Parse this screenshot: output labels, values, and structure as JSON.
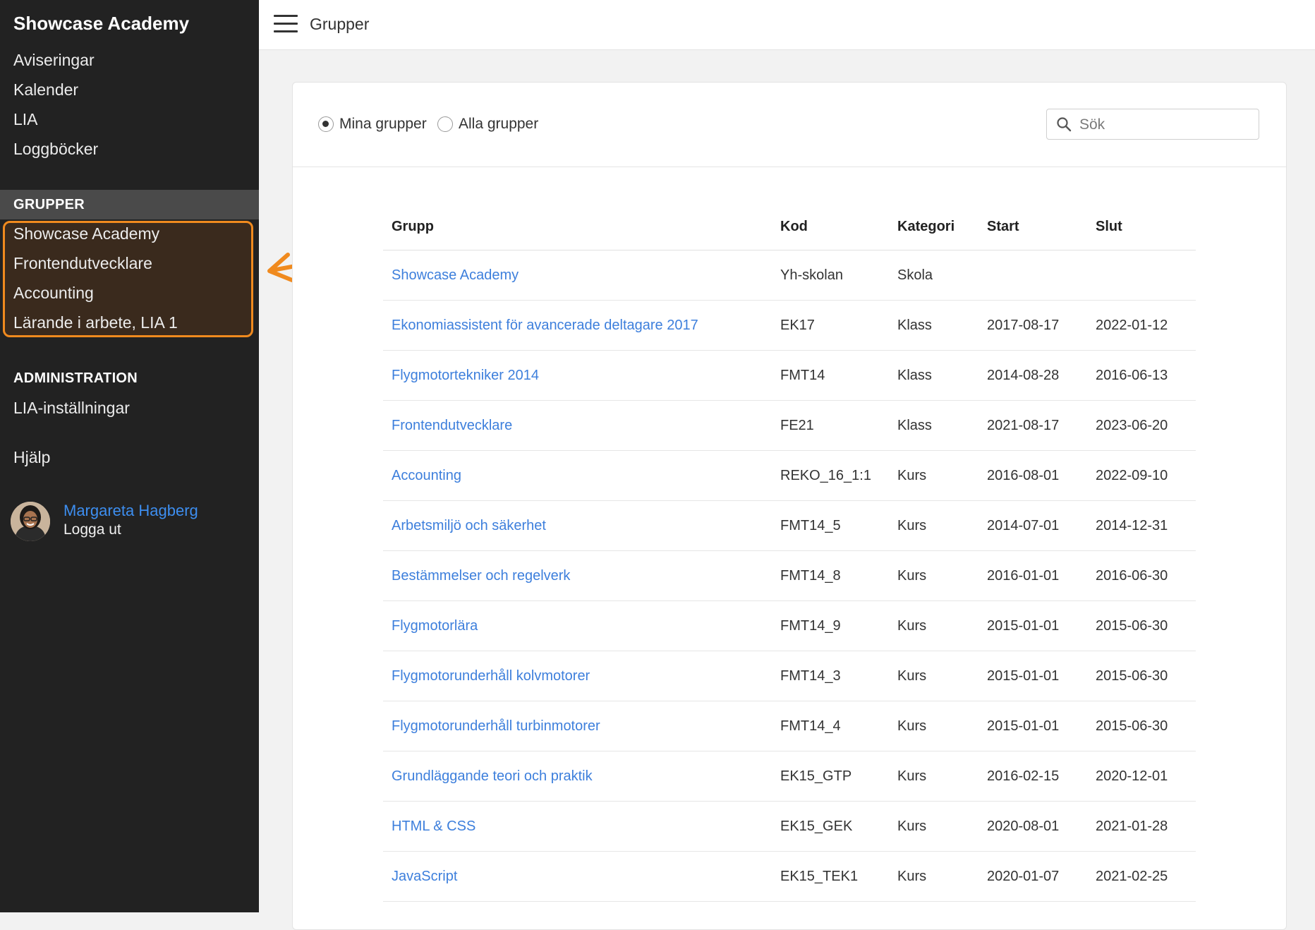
{
  "sidebar": {
    "brand": "Showcase Academy",
    "nav": [
      "Aviseringar",
      "Kalender",
      "LIA",
      "Loggböcker"
    ],
    "groups_heading": "GRUPPER",
    "groups": [
      "Showcase Academy",
      "Frontendutvecklare",
      "Accounting",
      "Lärande i arbete, LIA 1"
    ],
    "admin_heading": "ADMINISTRATION",
    "admin_items": [
      "LIA-inställningar"
    ],
    "help": "Hjälp",
    "user": {
      "name": "Margareta Hagberg",
      "logout": "Logga ut"
    }
  },
  "topbar": {
    "title": "Grupper"
  },
  "filters": {
    "mine": "Mina grupper",
    "all": "Alla grupper",
    "selected": "mine",
    "search_placeholder": "Sök"
  },
  "table": {
    "headers": [
      "Grupp",
      "Kod",
      "Kategori",
      "Start",
      "Slut"
    ],
    "rows": [
      [
        "Showcase Academy",
        "Yh-skolan",
        "Skola",
        "",
        ""
      ],
      [
        "Ekonomiassistent för avancerade deltagare 2017",
        "EK17",
        "Klass",
        "2017-08-17",
        "2022-01-12"
      ],
      [
        "Flygmotortekniker 2014",
        "FMT14",
        "Klass",
        "2014-08-28",
        "2016-06-13"
      ],
      [
        "Frontendutvecklare",
        "FE21",
        "Klass",
        "2021-08-17",
        "2023-06-20"
      ],
      [
        "Accounting",
        "REKO_16_1:1",
        "Kurs",
        "2016-08-01",
        "2022-09-10"
      ],
      [
        "Arbetsmiljö och säkerhet",
        "FMT14_5",
        "Kurs",
        "2014-07-01",
        "2014-12-31"
      ],
      [
        "Bestämmelser och regelverk",
        "FMT14_8",
        "Kurs",
        "2016-01-01",
        "2016-06-30"
      ],
      [
        "Flygmotorlära",
        "FMT14_9",
        "Kurs",
        "2015-01-01",
        "2015-06-30"
      ],
      [
        "Flygmotorunderhåll kolvmotorer",
        "FMT14_3",
        "Kurs",
        "2015-01-01",
        "2015-06-30"
      ],
      [
        "Flygmotorunderhåll turbinmotorer",
        "FMT14_4",
        "Kurs",
        "2015-01-01",
        "2015-06-30"
      ],
      [
        "Grundläggande teori och praktik",
        "EK15_GTP",
        "Kurs",
        "2016-02-15",
        "2020-12-01"
      ],
      [
        "HTML & CSS",
        "EK15_GEK",
        "Kurs",
        "2020-08-01",
        "2021-01-28"
      ],
      [
        "JavaScript",
        "EK15_TEK1",
        "Kurs",
        "2020-01-07",
        "2021-02-25"
      ]
    ]
  },
  "colors": {
    "sidebar_bg": "#222222",
    "highlight": "#f08a1e",
    "link": "#3d7fdc"
  }
}
